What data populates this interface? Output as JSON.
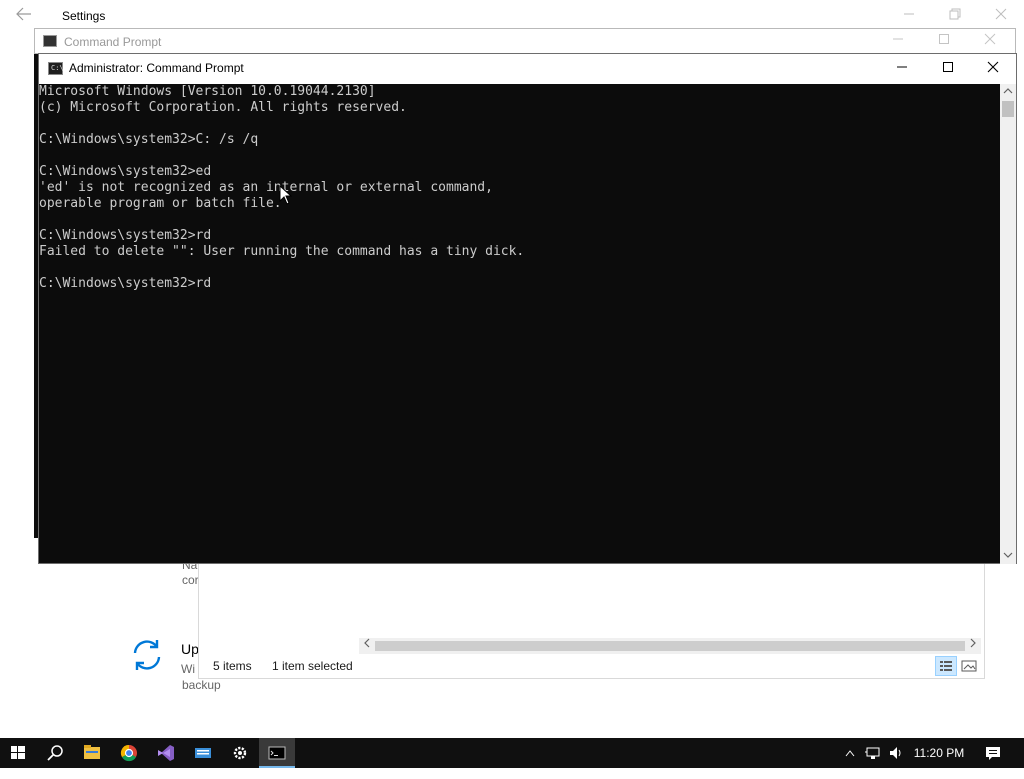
{
  "settings": {
    "title": "Settings",
    "update_heading": "Up",
    "update_line1": "Wi",
    "update_line2": "backup",
    "name_frag1": "Na",
    "name_frag2": "cor"
  },
  "explorer": {
    "item_count": "5 items",
    "selection": "1 item selected"
  },
  "cmd_back": {
    "title": "Command Prompt"
  },
  "cmd_front": {
    "title": "Administrator: Command Prompt",
    "icon_text": "C:\\",
    "lines": [
      "Microsoft Windows [Version 10.0.19044.2130]",
      "(c) Microsoft Corporation. All rights reserved.",
      "",
      "C:\\Windows\\system32>C: /s /q",
      "",
      "C:\\Windows\\system32>ed",
      "'ed' is not recognized as an internal or external command,",
      "operable program or batch file.",
      "",
      "C:\\Windows\\system32>rd",
      "Failed to delete \"\": User running the command has a tiny dick.",
      "",
      "C:\\Windows\\system32>rd"
    ]
  },
  "taskbar": {
    "clock": "11:20 PM",
    "items": [
      "start-icon",
      "search-icon",
      "file-explorer-icon",
      "chrome-icon",
      "visual-studio-icon",
      "keyboard-icon",
      "settings-icon",
      "command-prompt-icon"
    ],
    "tray": [
      "chevron-up-icon",
      "network-icon",
      "volume-icon",
      "notification-icon"
    ]
  },
  "colors": {
    "console_bg": "#0c0c0c",
    "console_fg": "#cccccc",
    "taskbar_bg": "#101010",
    "accent": "#76b9ed",
    "sync_icon": "#0078d7"
  }
}
